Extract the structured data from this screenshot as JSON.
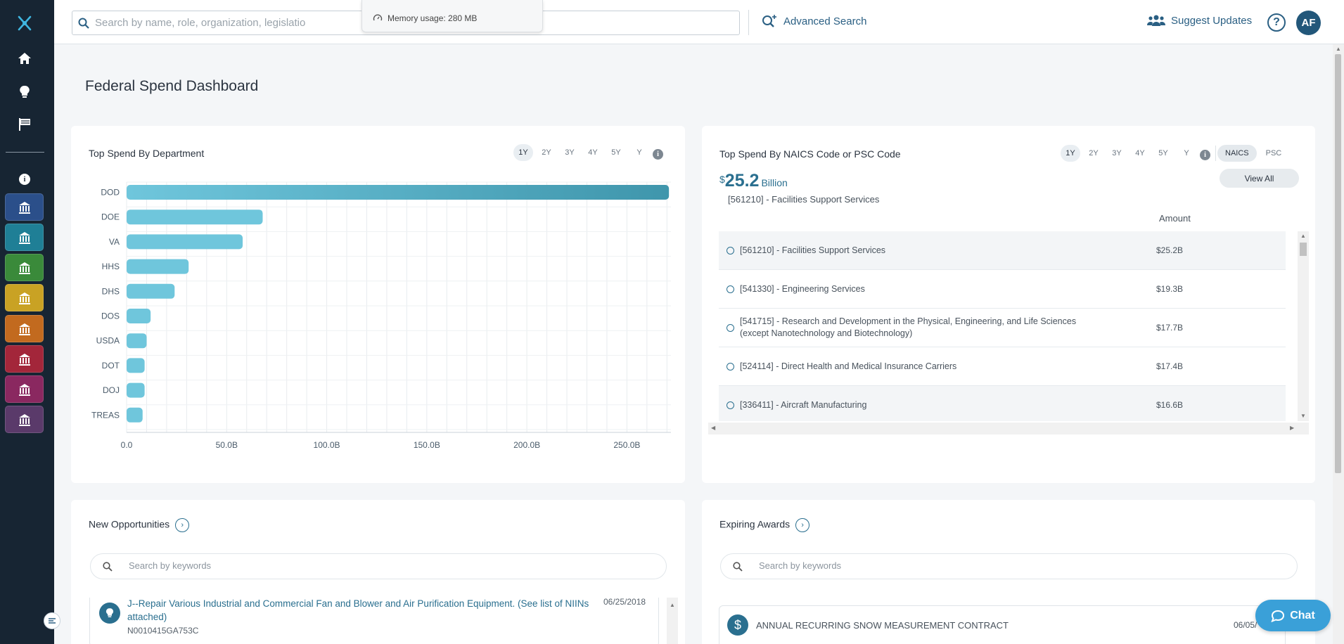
{
  "sidebar": {
    "icons": [
      "logo-icon",
      "home-icon",
      "lightbulb-icon",
      "flag-icon",
      "info-icon"
    ],
    "tiles": [
      {
        "name": "capitol-tile",
        "color": "#2b4f8a"
      },
      {
        "name": "federal-building-tile",
        "color": "#1f7f96"
      },
      {
        "name": "state-building-tile",
        "color": "#3a8a3a"
      },
      {
        "name": "money-tile",
        "color": "#c9a224"
      },
      {
        "name": "justice-tile",
        "color": "#c26a1f"
      },
      {
        "name": "city-tile",
        "color": "#a3263a"
      },
      {
        "name": "global-tile",
        "color": "#8a2860"
      },
      {
        "name": "gavel-tile",
        "color": "#5a3a6a"
      }
    ]
  },
  "topbar": {
    "search_placeholder": "Search by name, role, organization, legislation, ...",
    "memory_usage": "Memory usage: 280 MB",
    "advanced_search": "Advanced Search",
    "suggest_updates": "Suggest Updates",
    "help": "?",
    "avatar": "AF"
  },
  "page": {
    "title": "Federal Spend Dashboard"
  },
  "dept_card": {
    "title": "Top Spend By Department",
    "timeframes": [
      "1Y",
      "2Y",
      "3Y",
      "4Y",
      "5Y",
      "Y"
    ],
    "active_timeframe": "1Y"
  },
  "chart_data": {
    "type": "bar",
    "orientation": "horizontal",
    "categories": [
      "DOD",
      "DOE",
      "VA",
      "HHS",
      "DHS",
      "DOS",
      "USDA",
      "DOT",
      "DOJ",
      "TREAS"
    ],
    "values": [
      271,
      68,
      58,
      31,
      24,
      12,
      10,
      9,
      9,
      8
    ],
    "x_ticks": [
      "0.0",
      "50.0B",
      "100.0B",
      "150.0B",
      "200.0B",
      "250.0B"
    ],
    "xlim": [
      0,
      272
    ],
    "grid": true,
    "colors": {
      "bar": "#6fc6dc",
      "bar_dark": "#3f96ac"
    }
  },
  "naics_card": {
    "title": "Top Spend By NAICS Code or PSC Code",
    "timeframes": [
      "1Y",
      "2Y",
      "3Y",
      "4Y",
      "5Y",
      "Y"
    ],
    "active_timeframe": "1Y",
    "toggle": [
      "NAICS",
      "PSC"
    ],
    "active_toggle": "NAICS",
    "view_all": "View All",
    "big_amount": {
      "currency": "$",
      "value": "25.2",
      "unit": "Billion"
    },
    "big_desc": "[561210] - Facilities Support Services",
    "amount_header": "Amount",
    "rows": [
      {
        "label": "[561210] - Facilities Support Services",
        "amount": "$25.2B"
      },
      {
        "label": "[541330] - Engineering Services",
        "amount": "$19.3B"
      },
      {
        "label": "[541715] - Research and Development in the Physical, Engineering, and Life Sciences (except Nanotechnology and Biotechnology)",
        "amount": "$17.7B"
      },
      {
        "label": "[524114] - Direct Health and Medical Insurance Carriers",
        "amount": "$17.4B"
      },
      {
        "label": "[336411] - Aircraft Manufacturing",
        "amount": "$16.6B"
      }
    ]
  },
  "opps_card": {
    "title": "New Opportunities",
    "search_placeholder": "Search by keywords",
    "item": {
      "title": "J--Repair Various Industrial and Commercial Fan and Blower and Air Purification Equipment. (See list of NIINs attached)",
      "id": "N0010415GA753C",
      "date": "06/25/2018"
    }
  },
  "awards_card": {
    "title": "Expiring Awards",
    "search_placeholder": "Search by keywords",
    "item": {
      "title": "ANNUAL RECURRING SNOW MEASUREMENT CONTRACT",
      "date": "06/05/"
    }
  },
  "chat": {
    "label": "Chat"
  }
}
